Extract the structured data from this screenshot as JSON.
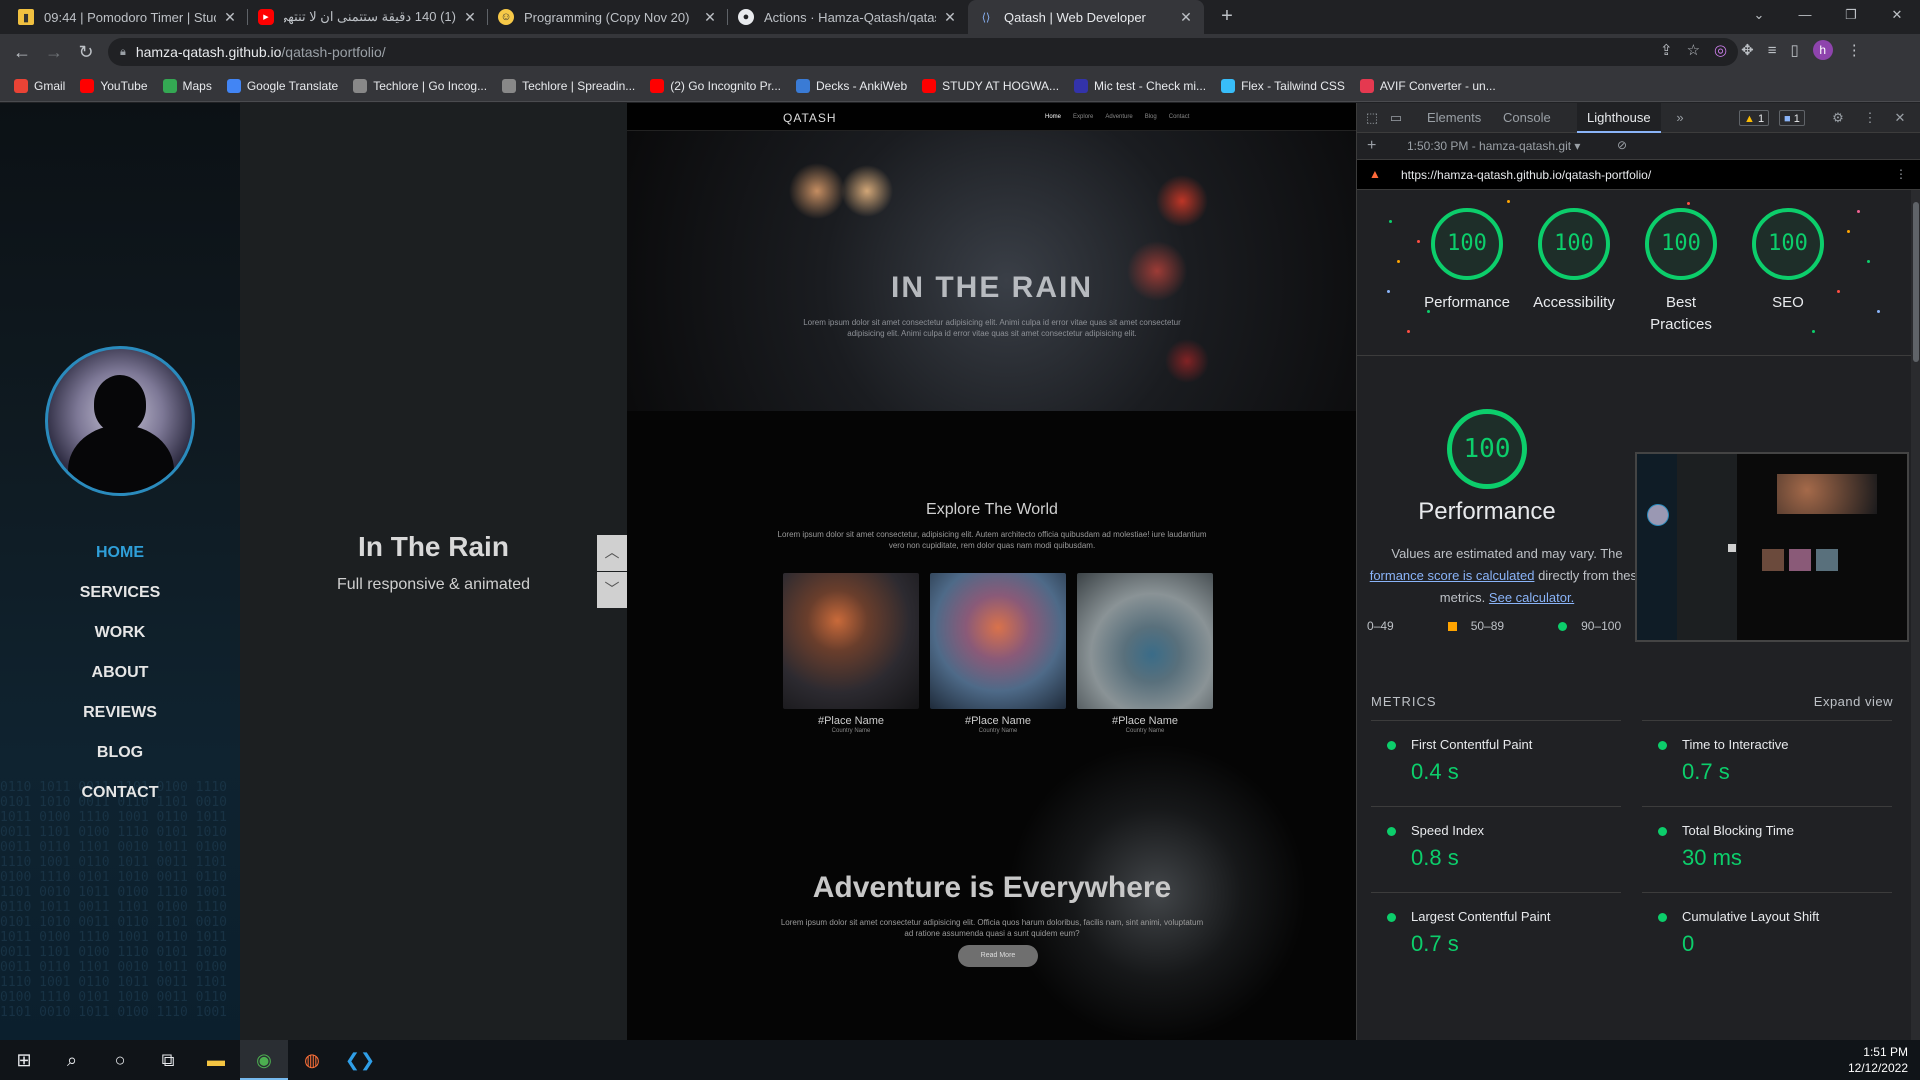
{
  "tabs": [
    {
      "title": "09:44 | Pomodoro Timer | Study W",
      "icon": "pomodoro-icon"
    },
    {
      "title": "(1) 140 دقيقة ستتمنى ان لا تنتهي",
      "icon": "youtube-icon"
    },
    {
      "title": "Programming (Copy Nov 20)",
      "icon": "emoji-icon"
    },
    {
      "title": "Actions · Hamza-Qatash/qatash-p",
      "icon": "github-icon"
    },
    {
      "title": "Qatash | Web Developer",
      "icon": "site-icon"
    }
  ],
  "address": {
    "host": "hamza-qatash.github.io",
    "path": "/qatash-portfolio/"
  },
  "profile_initial": "h",
  "bookmarks": [
    {
      "label": "Gmail",
      "color": "#ea4335"
    },
    {
      "label": "YouTube",
      "color": "#ff0000"
    },
    {
      "label": "Maps",
      "color": "#34a853"
    },
    {
      "label": "Google Translate",
      "color": "#4285f4"
    },
    {
      "label": "Techlore | Go Incog...",
      "color": "#888888"
    },
    {
      "label": "Techlore | Spreadin...",
      "color": "#888888"
    },
    {
      "label": "(2) Go Incognito Pr...",
      "color": "#ff0000"
    },
    {
      "label": "Decks - AnkiWeb",
      "color": "#3a7bd5"
    },
    {
      "label": "STUDY AT HOGWA...",
      "color": "#ff0000"
    },
    {
      "label": "Mic test - Check mi...",
      "color": "#3333aa"
    },
    {
      "label": "Flex - Tailwind CSS",
      "color": "#38bdf8"
    },
    {
      "label": "AVIF Converter - un...",
      "color": "#e53950"
    }
  ],
  "site": {
    "nav": [
      "HOME",
      "SERVICES",
      "WORK",
      "ABOUT",
      "REVIEWS",
      "BLOG",
      "CONTACT"
    ],
    "caption_title": "In The Rain",
    "caption_sub": "Full responsive & animated",
    "preview": {
      "logo": "QATASH",
      "links": [
        "Home",
        "Explore",
        "Adventure",
        "Blog",
        "Contact"
      ],
      "hero_title": "IN THE RAIN",
      "hero_text": "Lorem ipsum dolor sit amet consectetur adipisicing elit. Animi culpa id error vitae quas sit amet consectetur adipisicing elit. Animi culpa id error vitae quas sit amet consectetur adipisicing elit.",
      "explore_title": "Explore The World",
      "explore_text": "Lorem ipsum dolor sit amet consectetur, adipisicing elit. Autem architecto officia quibusdam ad molestiae! iure laudantium vero non cupiditate, rem dolor quas nam modi quibusdam.",
      "cards": [
        {
          "place": "#Place Name",
          "country": "Country Name"
        },
        {
          "place": "#Place Name",
          "country": "Country Name"
        },
        {
          "place": "#Place Name",
          "country": "Country Name"
        }
      ],
      "adventure_title": "Adventure is Everywhere",
      "adventure_text": "Lorem ipsum dolor sit amet consectetur adipisicing elit. Officia quos harum doloribus, facilis nam, sint animi, voluptatum ad ratione assumenda quasi a sunt quidem eum?",
      "read_more": "Read More"
    }
  },
  "devtools": {
    "tabs": [
      "Elements",
      "Console",
      "Lighthouse"
    ],
    "active_tab": "Lighthouse",
    "warn_count": "1",
    "msg_count": "1",
    "report_time": "1:50:30 PM - hamza-qatash.git",
    "report_url": "https://hamza-qatash.github.io/qatash-portfolio/",
    "scores": [
      {
        "label": "Performance",
        "value": "100"
      },
      {
        "label": "Accessibility",
        "value": "100"
      },
      {
        "label": "Best Practices",
        "value": "100"
      },
      {
        "label": "SEO",
        "value": "100"
      }
    ],
    "perf_score": "100",
    "perf_title": "Performance",
    "estimate_1": "Values are estimated and may vary. The",
    "estimate_link1": "formance score is calculated",
    "estimate_2": " directly from these metrics.",
    "estimate_link2": "See calculator.",
    "legend": [
      "0–49",
      "50–89",
      "90–100"
    ],
    "metrics_heading": "METRICS",
    "expand_view": "Expand view",
    "metrics": [
      {
        "name": "First Contentful Paint",
        "value": "0.4 s"
      },
      {
        "name": "Time to Interactive",
        "value": "0.7 s"
      },
      {
        "name": "Speed Index",
        "value": "0.8 s"
      },
      {
        "name": "Total Blocking Time",
        "value": "30 ms"
      },
      {
        "name": "Largest Contentful Paint",
        "value": "0.7 s"
      },
      {
        "name": "Cumulative Layout Shift",
        "value": "0"
      }
    ],
    "colors": {
      "pass": "#0cce6b",
      "average": "#ffa400",
      "fail": "#ff4e42"
    }
  },
  "taskbar": {
    "icons": [
      "windows-start-icon",
      "search-icon",
      "cortana-icon",
      "task-view-icon",
      "file-explorer-icon",
      "chrome-icon",
      "firefox-icon",
      "vscode-icon"
    ],
    "time": "1:51 PM",
    "date": "12/12/2022"
  }
}
